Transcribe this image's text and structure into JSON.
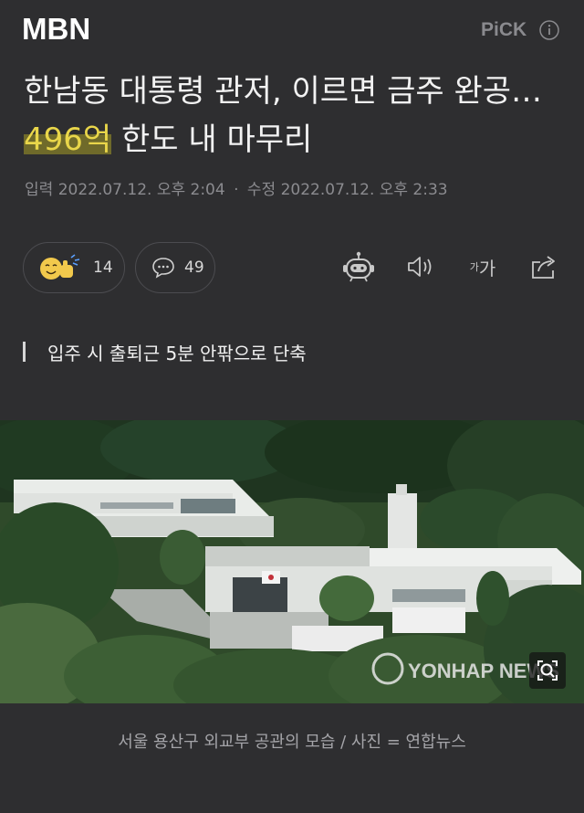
{
  "brand": {
    "logo_text": "MBN",
    "pick_label": "PiCK"
  },
  "article": {
    "headline_part1": "한남동 대통령 관저, 이르면 금주 완공…",
    "headline_highlight": "496억",
    "headline_part2": " 한도 내 마무리",
    "published_label": "입력",
    "published_time": "2022.07.12. 오후 2:04",
    "modified_label": "수정",
    "modified_time": "2022.07.12. 오후 2:33",
    "subheading": "입주 시 출퇴근 5분 안팎으로 단축",
    "photo_watermark": "YONHAP NEWS",
    "caption": "서울 용산구 외교부 공관의 모습 / 사진 = 연합뉴스"
  },
  "actions": {
    "reaction_count": "14",
    "comment_count": "49",
    "font_size_small": "가",
    "font_size_big": "가"
  },
  "colors": {
    "background": "#2e2e30",
    "highlight_text": "#e9d64a",
    "highlight_bg": "#6f6a2a"
  },
  "icons": [
    "info-icon",
    "reaction-emoji-icon",
    "comment-icon",
    "summary-bot-icon",
    "speaker-icon",
    "font-size-icon",
    "share-icon",
    "zoom-icon"
  ]
}
